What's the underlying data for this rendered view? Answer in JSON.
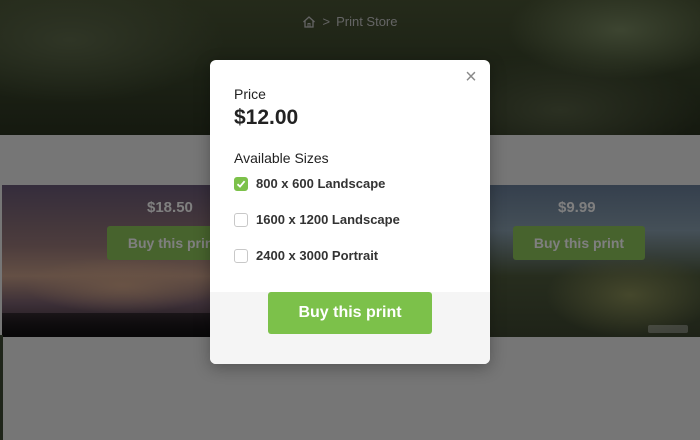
{
  "breadcrumb": {
    "home_icon": "home-icon",
    "separator": ">",
    "current": "Print Store"
  },
  "cards": [
    {
      "price": "$18.50",
      "button_label": "Buy this print"
    },
    {
      "price": "$9.99",
      "button_label": "Buy this print"
    }
  ],
  "modal": {
    "close_icon": "close-icon",
    "close_glyph": "×",
    "price_label": "Price",
    "price_value": "$12.00",
    "sizes_label": "Available Sizes",
    "sizes": [
      {
        "label": "800 x 600 Landscape",
        "checked": true
      },
      {
        "label": "1600 x 1200 Landscape",
        "checked": false
      },
      {
        "label": "2400 x 3000 Portrait",
        "checked": false
      }
    ],
    "buy_label": "Buy this print"
  },
  "colors": {
    "accent": "#7cc14a",
    "overlay": "rgba(0,0,0,0.5)"
  }
}
